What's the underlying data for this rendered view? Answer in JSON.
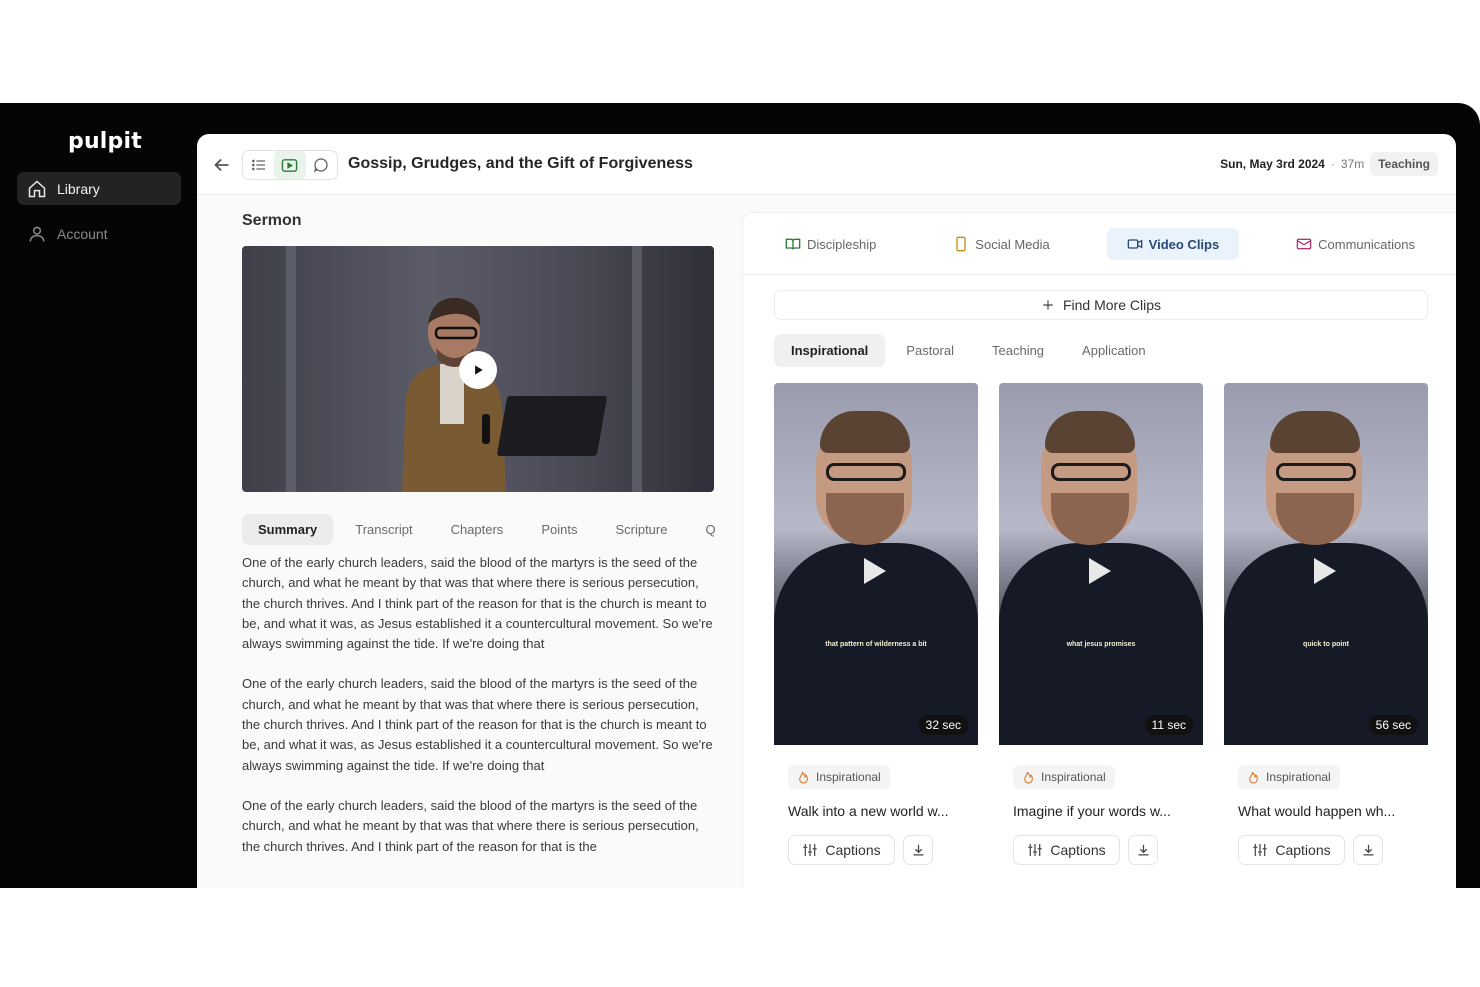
{
  "sidebar": {
    "logo": "pulpit",
    "items": [
      {
        "label": "Library",
        "icon": "home-icon",
        "active": true
      },
      {
        "label": "Account",
        "icon": "user-icon",
        "active": false
      }
    ]
  },
  "header": {
    "title": "Gossip, Grudges, and the Gift of Forgiveness",
    "date": "Sun, May 3rd 2024",
    "separator": "·",
    "duration": "37m",
    "badge": "Teaching"
  },
  "sermon": {
    "section_title": "Sermon",
    "tabs": [
      "Summary",
      "Transcript",
      "Chapters",
      "Points",
      "Scripture",
      "Q"
    ],
    "active_tab": "Summary",
    "paragraphs": [
      "One of the early church leaders, said the blood of the martyrs is the seed of the church, and what he meant by that was that where there is serious persecution, the church thrives. And I think part of the reason for that is the church is meant to be, and what it was, as Jesus established it a countercultural movement. So we're always swimming against the tide. If we're doing that",
      "One of the early church leaders, said the blood of the martyrs is the seed of the church, and what he meant by that was that where there is serious persecution, the church thrives. And I think part of the reason for that is the church is meant to be, and what it was, as Jesus established it a countercultural movement. So we're always swimming against the tide. If we're doing that",
      "One of the early church leaders, said the blood of the martyrs is the seed of the church, and what he meant by that was that where there is serious persecution, the church thrives. And I think part of the reason for that is the"
    ]
  },
  "content": {
    "top_tabs": [
      {
        "label": "Discipleship",
        "icon": "book-icon",
        "color": "#2f7a3a"
      },
      {
        "label": "Social Media",
        "icon": "phone-icon",
        "color": "#c98a1a"
      },
      {
        "label": "Video Clips",
        "icon": "video-icon",
        "color": "#2b4a72",
        "active": true
      },
      {
        "label": "Communications",
        "icon": "mail-icon",
        "color": "#b03a7a"
      }
    ],
    "find_more": "Find More Clips",
    "categories": [
      "Inspirational",
      "Pastoral",
      "Teaching",
      "Application"
    ],
    "active_category": "Inspirational",
    "clips": [
      {
        "duration": "32 sec",
        "tag": "Inspirational",
        "title": "Walk into a new world w...",
        "caption_overlay": "that pattern of wilderness a bit",
        "captions_label": "Captions"
      },
      {
        "duration": "11 sec",
        "tag": "Inspirational",
        "title": "Imagine if your words w...",
        "caption_overlay": "what jesus promises",
        "captions_label": "Captions"
      },
      {
        "duration": "56 sec",
        "tag": "Inspirational",
        "title": "What would happen wh...",
        "caption_overlay": "quick to point",
        "captions_label": "Captions"
      }
    ]
  },
  "colors": {
    "accent_green": "#2f7a3a",
    "accent_blue": "#2b4a72",
    "tag_fire": "#e0752c"
  }
}
